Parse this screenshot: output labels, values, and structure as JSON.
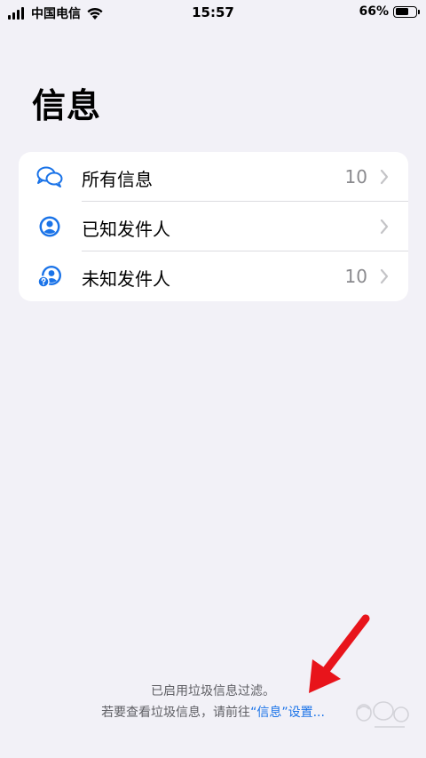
{
  "status_bar": {
    "carrier": "中国电信",
    "time": "15:57",
    "battery_percent": "66%",
    "battery_level": 0.66
  },
  "page": {
    "title": "信息"
  },
  "filters": [
    {
      "label": "所有信息",
      "count": "10",
      "icon": "chat-bubbles-icon"
    },
    {
      "label": "已知发件人",
      "count": "",
      "icon": "person-circle-icon"
    },
    {
      "label": "未知发件人",
      "count": "10",
      "icon": "person-question-icon"
    }
  ],
  "footer": {
    "line1": "已启用垃圾信息过滤。",
    "line2_prefix": "若要查看垃圾信息，请前往",
    "line2_link": "“信息”设置..."
  },
  "colors": {
    "background": "#f2f1f7",
    "accent": "#1a73e8",
    "annotation": "#e8141b"
  }
}
